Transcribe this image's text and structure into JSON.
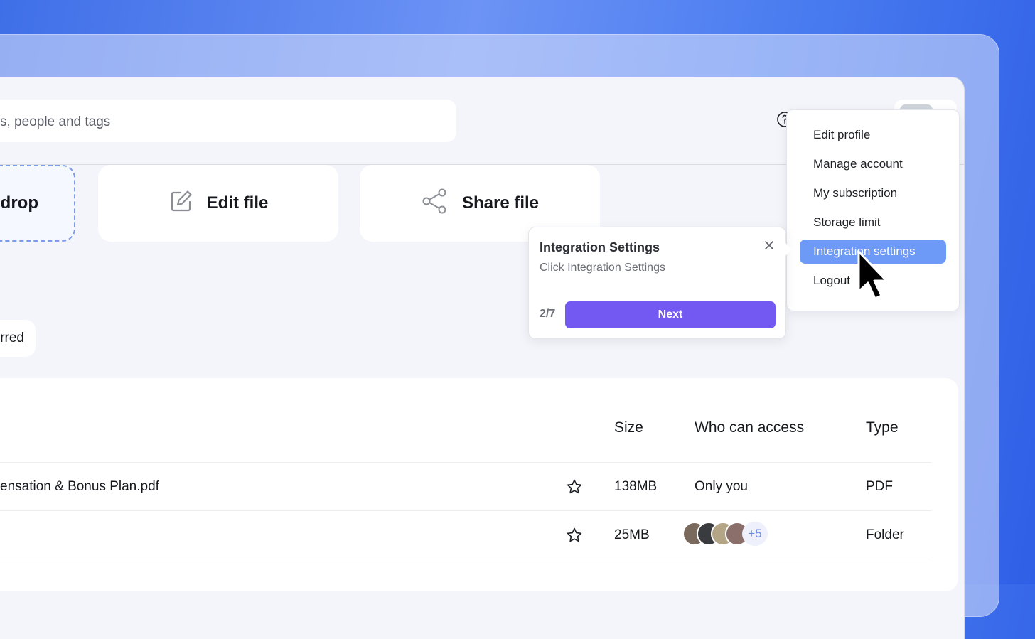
{
  "search": {
    "placeholder": "s, people and tags"
  },
  "header": {
    "icons": [
      "help-icon",
      "bell-icon",
      "upload-icon"
    ],
    "avatar_menu_icon": "chevron-up-icon"
  },
  "account_menu": {
    "items": [
      {
        "label": "Edit profile"
      },
      {
        "label": "Manage account"
      },
      {
        "label": "My subscription"
      },
      {
        "label": "Storage limit"
      },
      {
        "label": "Integration settings",
        "active": true
      },
      {
        "label": "Logout"
      }
    ]
  },
  "quick_actions": {
    "drop_label": "drop",
    "edit_label": "Edit file",
    "share_label": "Share file"
  },
  "filters": {
    "starred_label": "rred"
  },
  "tour": {
    "title": "Integration Settings",
    "subtitle": "Click Integration Settings",
    "step": "2/7",
    "next_label": "Next"
  },
  "files_table": {
    "columns": {
      "size": "Size",
      "access": "Who can access",
      "type": "Type"
    },
    "rows": [
      {
        "name": "ensation & Bonus Plan.pdf",
        "size": "138MB",
        "access": "Only you",
        "type": "PDF"
      },
      {
        "name": "",
        "size": "25MB",
        "access_more": "+5",
        "type": "Folder"
      }
    ]
  },
  "colors": {
    "accent_purple": "#7458f2",
    "menu_active": "#6d9af6",
    "background_gradient": "#4a7cf0"
  }
}
